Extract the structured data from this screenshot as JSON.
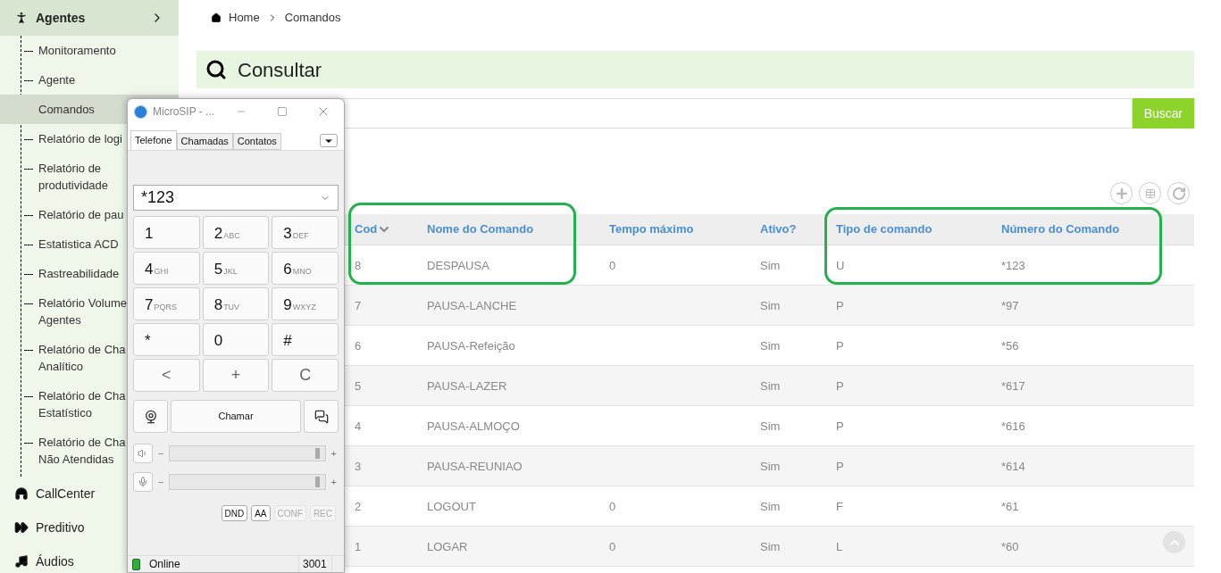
{
  "sidebar": {
    "sections": [
      {
        "label": "Agentes",
        "children": [
          {
            "label": "Monitoramento",
            "selected": false
          },
          {
            "label": "Agente",
            "selected": false
          },
          {
            "label": "Comandos",
            "selected": true
          },
          {
            "label": "Relatório de logi",
            "selected": false
          },
          {
            "label": "Relatório de\nprodutividade",
            "selected": false
          },
          {
            "label": "Relatório de pau",
            "selected": false
          },
          {
            "label": "Estatistica ACD",
            "selected": false
          },
          {
            "label": "Rastreabilidade",
            "selected": false
          },
          {
            "label": "Relatório Volume\nAgentes",
            "selected": false
          },
          {
            "label": "Relatório de Cha\nAnalítico",
            "selected": false
          },
          {
            "label": "Relatório de Cha\nEstatístico",
            "selected": false
          },
          {
            "label": "Relatório de Cha\nNão Atendidas",
            "selected": false
          }
        ]
      },
      {
        "label": "CallCenter"
      },
      {
        "label": "Preditivo"
      },
      {
        "label": "Áudios"
      }
    ]
  },
  "breadcrumb": [
    "Home",
    "Comandos"
  ],
  "panel": {
    "title": "Consultar",
    "search_button": "Buscar"
  },
  "table": {
    "columns": [
      {
        "label": "Cod",
        "sorted": true
      },
      {
        "label": "Nome do Comando",
        "sorted": false
      },
      {
        "label": "Tempo máximo",
        "sorted": false
      },
      {
        "label": "Ativo?",
        "sorted": false
      },
      {
        "label": "Tipo de comando",
        "sorted": false
      },
      {
        "label": "Número do Comando",
        "sorted": false
      }
    ],
    "rows": [
      [
        "8",
        "DESPAUSA",
        "0",
        "Sim",
        "U",
        "*123"
      ],
      [
        "7",
        "PAUSA-LANCHE",
        "",
        "Sim",
        "P",
        "*97"
      ],
      [
        "6",
        "PAUSA-Refeição",
        "",
        "Sim",
        "P",
        "*56"
      ],
      [
        "5",
        "PAUSA-LAZER",
        "",
        "Sim",
        "P",
        "*617"
      ],
      [
        "4",
        "PAUSA-ALMOÇO",
        "",
        "Sim",
        "P",
        "*616"
      ],
      [
        "3",
        "PAUSA-REUNIAO",
        "",
        "Sim",
        "P",
        "*614"
      ],
      [
        "2",
        "LOGOUT",
        "0",
        "Sim",
        "F",
        "*61"
      ],
      [
        "1",
        "LOGAR",
        "0",
        "Sim",
        "L",
        "*60"
      ]
    ]
  },
  "phone": {
    "title": "MicroSIP - ...",
    "tabs": [
      {
        "label": "Telefone",
        "selected": true
      },
      {
        "label": "Chamadas",
        "selected": false
      },
      {
        "label": "Contatos",
        "selected": false
      }
    ],
    "number": "*123",
    "keys": [
      {
        "digit": "1"
      },
      {
        "digit": "2",
        "letters": "ABC"
      },
      {
        "digit": "3",
        "letters": "DEF"
      },
      {
        "digit": "4",
        "letters": "GHI"
      },
      {
        "digit": "5",
        "letters": "JKL"
      },
      {
        "digit": "6",
        "letters": "MNO"
      },
      {
        "digit": "7",
        "letters": "PQRS"
      },
      {
        "digit": "8",
        "letters": "TUV"
      },
      {
        "digit": "9",
        "letters": "WXYZ"
      },
      {
        "digit": "*"
      },
      {
        "digit": "0"
      },
      {
        "digit": "#"
      }
    ],
    "edit_keys": [
      "<",
      "+",
      "C"
    ],
    "call_button": "Chamar",
    "sliders": [
      {
        "minus": "−",
        "plus": "+",
        "level": 0.97
      },
      {
        "minus": "−",
        "plus": "+",
        "level": 0.97
      }
    ],
    "toggles": [
      {
        "label": "DND",
        "disabled": false
      },
      {
        "label": "AA",
        "disabled": false
      },
      {
        "label": "CONF",
        "disabled": true
      },
      {
        "label": "REC",
        "disabled": true
      }
    ],
    "status": "Online",
    "extension": "3001"
  }
}
